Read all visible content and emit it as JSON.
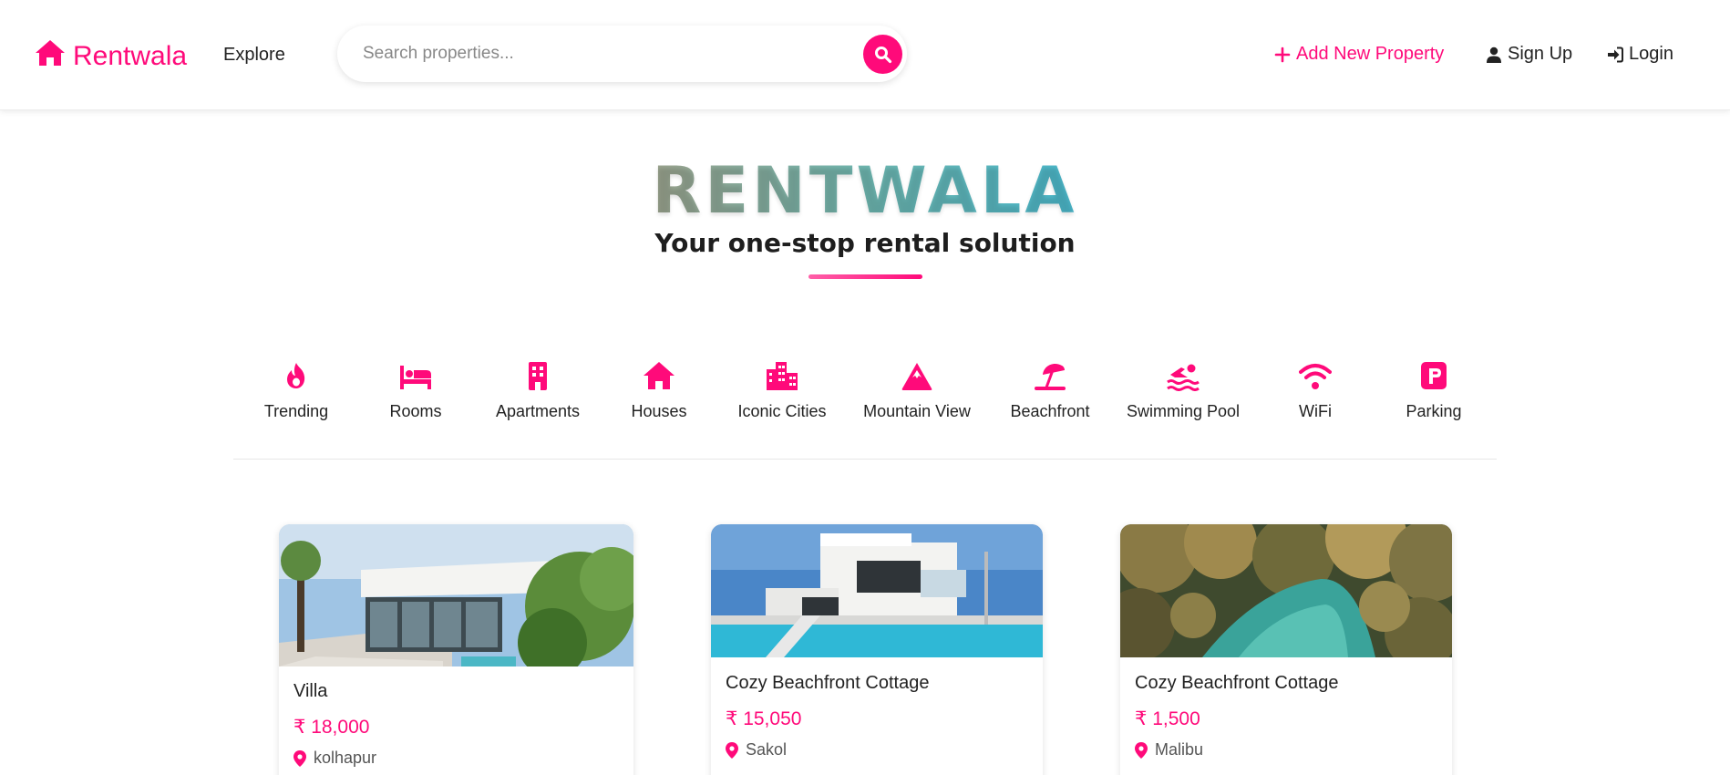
{
  "navbar": {
    "brand": "Rentwala",
    "explore": "Explore",
    "search_placeholder": "Search properties...",
    "add_property": "Add New Property",
    "sign_up": "Sign Up",
    "login": "Login"
  },
  "hero": {
    "title": "RENTWALA",
    "subtitle": "Your one-stop rental solution"
  },
  "filters": [
    {
      "label": "Trending",
      "icon": "fire-icon"
    },
    {
      "label": "Rooms",
      "icon": "bed-icon"
    },
    {
      "label": "Apartments",
      "icon": "building-icon"
    },
    {
      "label": "Houses",
      "icon": "house-icon"
    },
    {
      "label": "Iconic Cities",
      "icon": "city-icon"
    },
    {
      "label": "Mountain View",
      "icon": "mountain-icon"
    },
    {
      "label": "Beachfront",
      "icon": "umbrella-beach-icon"
    },
    {
      "label": "Swimming Pool",
      "icon": "swimmer-icon"
    },
    {
      "label": "WiFi",
      "icon": "wifi-icon"
    },
    {
      "label": "Parking",
      "icon": "parking-icon"
    }
  ],
  "listings": [
    {
      "title": "Villa",
      "price": "₹ 18,000",
      "location": "kolhapur"
    },
    {
      "title": "Cozy Beachfront Cottage",
      "price": "₹ 15,050",
      "location": "Sakol"
    },
    {
      "title": "Cozy Beachfront Cottage",
      "price": "₹ 1,500",
      "location": "Malibu"
    }
  ],
  "colors": {
    "accent": "#ff0a7a",
    "text": "#222222"
  }
}
